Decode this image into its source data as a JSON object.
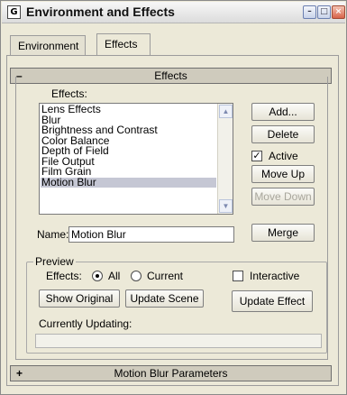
{
  "window": {
    "title": "Environment and Effects",
    "app_icon_glyph": "G",
    "minimize_glyph": "–",
    "maximize_glyph": "□",
    "close_glyph": "×"
  },
  "tabs": [
    {
      "label": "Environment",
      "active": false
    },
    {
      "label": "Effects",
      "active": true
    }
  ],
  "effects_rollout": {
    "sign": "–",
    "title": "Effects",
    "effects_label": "Effects:",
    "list_items": [
      "Lens Effects",
      "Blur",
      "Brightness and Contrast",
      "Color Balance",
      "Depth of Field",
      "File Output",
      "Film Grain",
      "Motion Blur"
    ],
    "selected_item": "Motion Blur",
    "scroll_up_glyph": "▲",
    "scroll_down_glyph": "▼",
    "buttons": {
      "add": "Add...",
      "delete": "Delete",
      "move_up": "Move Up",
      "move_down": "Move Down",
      "merge": "Merge"
    },
    "active_label": "Active",
    "active_checked": true,
    "check_glyph": "✓",
    "name_label": "Name:",
    "name_value": "Motion Blur"
  },
  "preview": {
    "group_title": "Preview",
    "effects_label": "Effects:",
    "radio_all": "All",
    "radio_current": "Current",
    "selected_radio": "All",
    "interactive_label": "Interactive",
    "interactive_checked": false,
    "show_original": "Show Original",
    "update_scene": "Update Scene",
    "update_effect": "Update Effect",
    "currently_updating_label": "Currently Updating:"
  },
  "params_rollout": {
    "sign": "+",
    "title": "Motion Blur Parameters"
  },
  "colors": {
    "panel_bg": "#ece9d8",
    "selection": "#c5c7d4",
    "rollout_header": "#cfcbbd",
    "close_button": "#d8634a"
  }
}
